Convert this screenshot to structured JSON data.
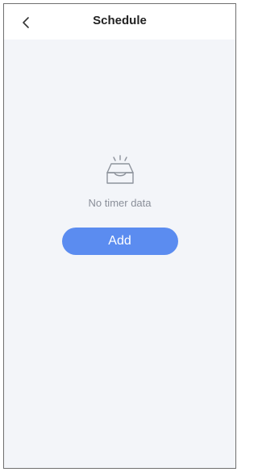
{
  "header": {
    "title": "Schedule",
    "back_icon": "chevron-left-icon"
  },
  "empty_state": {
    "icon": "empty-inbox-icon",
    "message": "No timer data"
  },
  "actions": {
    "add_label": "Add"
  },
  "colors": {
    "accent": "#5b8cf0",
    "background": "#f3f5f9",
    "header": "#ffffff"
  }
}
